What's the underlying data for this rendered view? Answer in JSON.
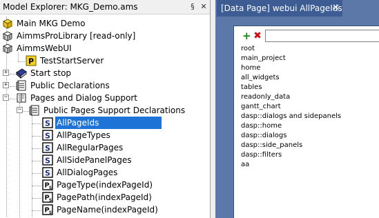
{
  "explorer": {
    "title": "Model Explorer: MKG_Demo.ams",
    "pin_glyph": "§",
    "close_glyph": "✕",
    "tree": [
      {
        "label": "Main MKG Demo",
        "icon": "main-model-icon"
      },
      {
        "label": "AimmsProLibrary [read-only]",
        "icon": "library-icon"
      },
      {
        "label": "AimmsWebUI",
        "icon": "library-icon"
      },
      {
        "label": "TestStartServer",
        "icon": "procedure-icon"
      },
      {
        "label": "Start stop",
        "icon": "book-icon",
        "toggle": "+"
      },
      {
        "label": "Public Declarations",
        "icon": "declaration-section-icon",
        "toggle": "+"
      },
      {
        "label": "Pages and Dialog Support",
        "icon": "book-section-icon",
        "toggle": "−"
      },
      {
        "label": "Public Pages Support Declarations",
        "icon": "declaration-section-icon",
        "toggle": "−"
      },
      {
        "label": "AllPageIds",
        "icon": "set-icon",
        "selected": true
      },
      {
        "label": "AllPageTypes",
        "icon": "set-icon"
      },
      {
        "label": "AllRegularPages",
        "icon": "set-icon"
      },
      {
        "label": "AllSidePanelPages",
        "icon": "set-icon"
      },
      {
        "label": "AllDialogPages",
        "icon": "set-icon"
      },
      {
        "label": "PageType(indexPageId)",
        "icon": "string-parameter-icon"
      },
      {
        "label": "PagePath(indexPageId)",
        "icon": "string-parameter-icon"
      },
      {
        "label": "PageName(indexPageId)",
        "icon": "string-parameter-icon"
      }
    ]
  },
  "data_page": {
    "tab_title": "[Data Page] webui AllPageIds",
    "tab_close": "✕",
    "add_symbol": "+",
    "delete_symbol": "✖",
    "input_value": "",
    "elements": [
      "root",
      "main_project",
      "home",
      "all_widgets",
      "tables",
      "readonly_data",
      "gantt_chart",
      "dasp::dialogs and sidepanels",
      "dasp::home",
      "dasp::dialogs",
      "dasp::side_panels",
      "dasp::filters",
      "aa"
    ]
  },
  "colors": {
    "selection": "#1e74d6",
    "right_background": "#5b78a8",
    "tab_background": "#3c5c93"
  }
}
